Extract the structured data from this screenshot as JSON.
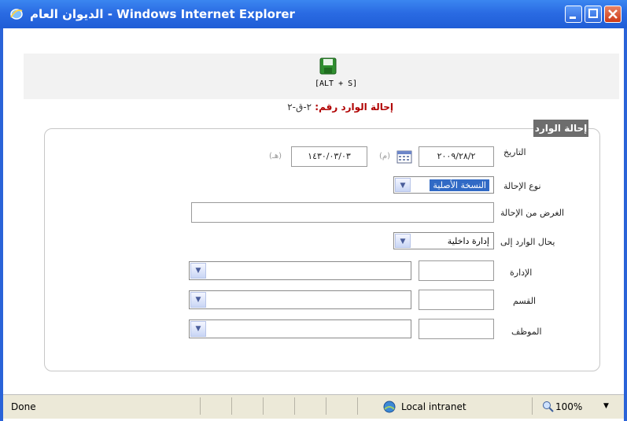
{
  "window": {
    "title": "الديوان العام - Windows Internet Explorer",
    "controls": {
      "minimize": "minimize",
      "maximize": "maximize",
      "close": "close"
    }
  },
  "toolbar": {
    "save_shortcut": "[ALT + S]"
  },
  "reference": {
    "label": "إحالة الوارد رقم:",
    "number": "٢-ق-٢"
  },
  "form": {
    "legend": "إحالة الوارد",
    "date": {
      "label": "التاريخ",
      "gregorian_value": "٢٠٠٩/٢٨/٢",
      "gregorian_suffix": "(م)",
      "hijri_value": "١٤٣٠/٠٣/٠٣",
      "hijri_suffix": "(هـ)"
    },
    "transfer_type": {
      "label": "نوع الإحالة",
      "selected": "النسخة الأصلية"
    },
    "purpose": {
      "label": "الغرض من الإحالة",
      "value": ""
    },
    "transfer_to": {
      "label": "يحال الوارد إلى",
      "selected": "إدارة داخلية"
    },
    "department": {
      "label": "الإدارة",
      "code": "",
      "selected": ""
    },
    "section": {
      "label": "القسم",
      "code": "",
      "selected": ""
    },
    "employee": {
      "label": "الموظف",
      "code": "",
      "selected": ""
    }
  },
  "status": {
    "text": "Done",
    "zone": "Local intranet",
    "zoom": "100%"
  }
}
